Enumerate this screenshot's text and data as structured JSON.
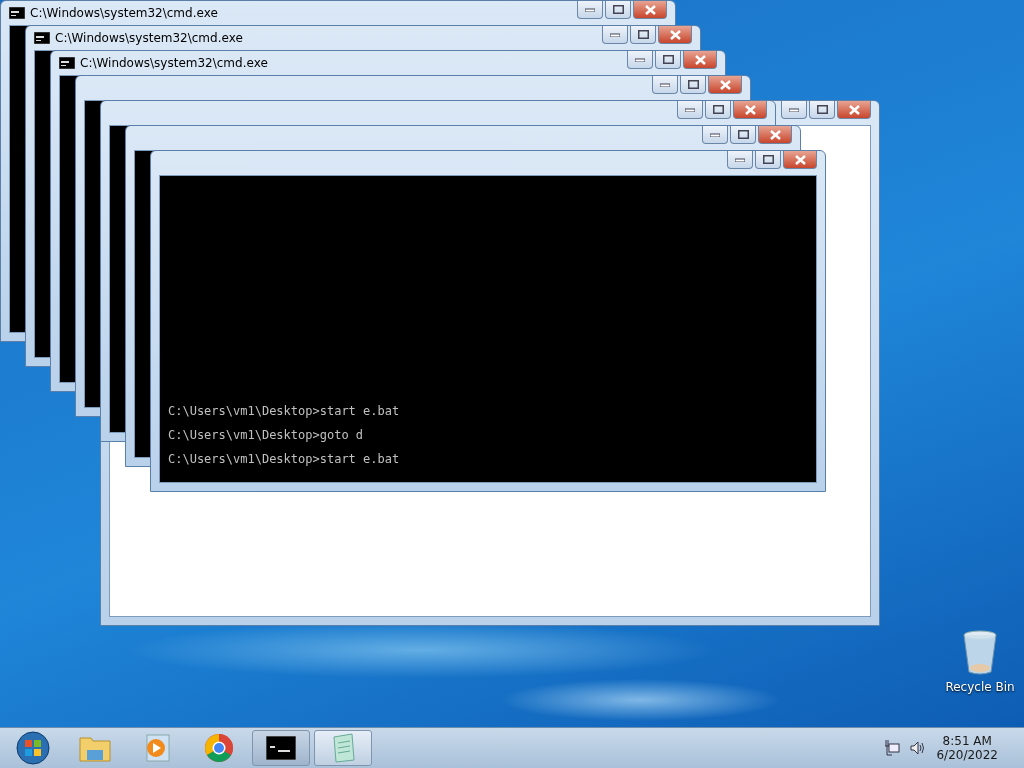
{
  "windows": [
    {
      "kind": "blank"
    },
    {
      "kind": "console",
      "title": "C:\\Windows\\system32\\cmd.exe"
    },
    {
      "kind": "console",
      "title": "C:\\Windows\\system32\\cmd.exe"
    },
    {
      "kind": "console",
      "title": "C:\\Windows\\system32\\cmd.exe"
    },
    {
      "kind": "console"
    },
    {
      "kind": "console"
    },
    {
      "kind": "console"
    },
    {
      "kind": "console",
      "lines": [
        "C:\\Users\\vm1\\Desktop>start e.bat",
        "C:\\Users\\vm1\\Desktop>goto d",
        "C:\\Users\\vm1\\Desktop>start e.bat"
      ]
    }
  ],
  "desktop_icons": [
    {
      "kind": "recycle",
      "label": "Recycle Bin"
    }
  ],
  "taskbar": {
    "items": [
      {
        "kind": "start",
        "open": false,
        "selected": false
      },
      {
        "kind": "explorer",
        "open": false,
        "selected": false
      },
      {
        "kind": "media",
        "open": false,
        "selected": false
      },
      {
        "kind": "chrome",
        "open": false,
        "selected": false
      },
      {
        "kind": "console",
        "open": true,
        "selected": true
      },
      {
        "kind": "notepad",
        "open": true,
        "selected": false
      }
    ],
    "clock": {
      "time": "8:51 AM",
      "date": "6/20/2022"
    }
  }
}
